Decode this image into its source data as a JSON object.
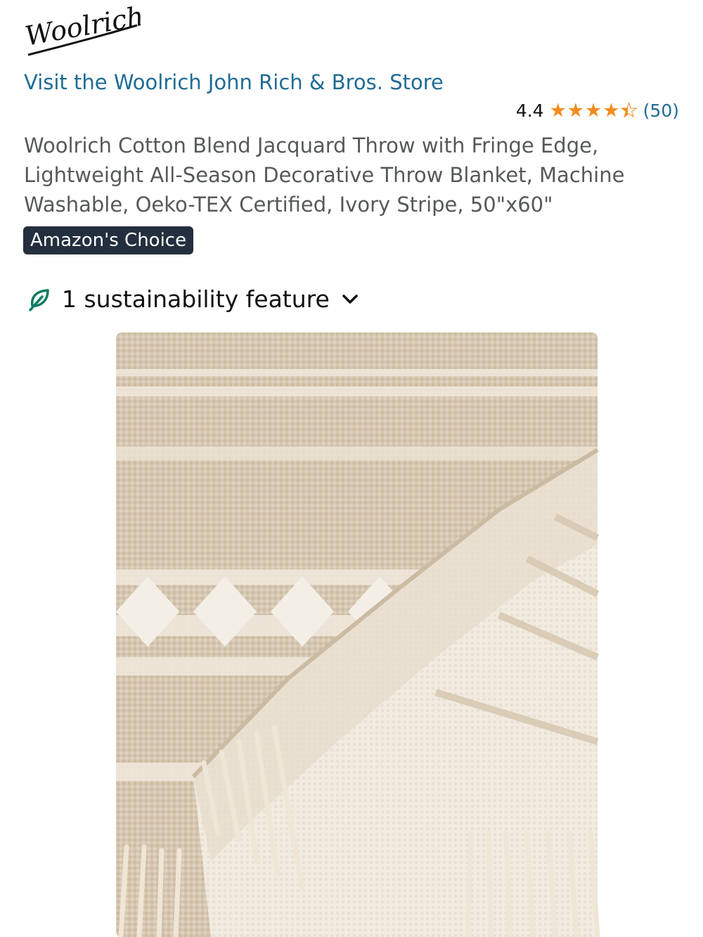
{
  "brand": {
    "logo_text": "Woolrich"
  },
  "store_link": "Visit the Woolrich John Rich & Bros. Store",
  "rating": {
    "value": "4.4",
    "stars": 4.4,
    "count": "(50)"
  },
  "product": {
    "title": "Woolrich Cotton Blend Jacquard Throw with Fringe Edge, Lightweight All-Season Decorative Throw Blanket, Machine Washable, Oeko-TEX Certified, Ivory Stripe, 50\"x60\"",
    "badge": "Amazon's Choice"
  },
  "sustainability": {
    "label": "1 sustainability feature",
    "icon": "leaf-icon"
  },
  "colors": {
    "link": "#1f6c94",
    "star": "#f28b1c",
    "badge_bg": "#232f3e",
    "leaf": "#067d62"
  }
}
